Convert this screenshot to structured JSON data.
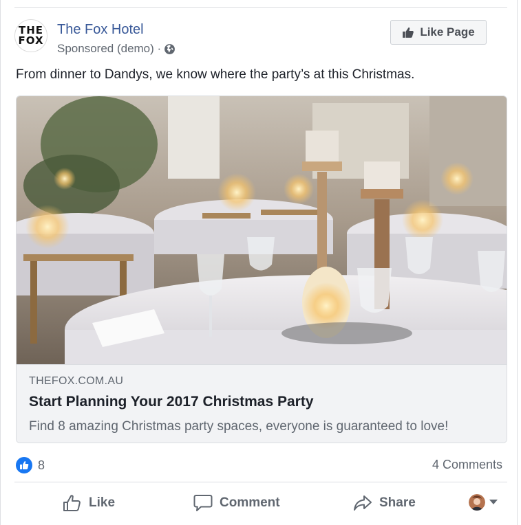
{
  "post": {
    "page_name": "The Fox Hotel",
    "avatar_line1": "THE",
    "avatar_line2": "FOX",
    "sponsored": "Sponsored (demo) ·",
    "like_page_label": "Like Page",
    "message": "From dinner to Dandys, we know where the party’s at this Christmas."
  },
  "link": {
    "domain": "THEFOX.COM.AU",
    "headline": "Start Planning Your 2017 Christmas Party",
    "description": "Find 8 amazing Christmas party spaces, everyone is guaranteed to love!"
  },
  "stats": {
    "like_count": "8",
    "comments": "4 Comments"
  },
  "actions": {
    "like": "Like",
    "comment": "Comment",
    "share": "Share"
  },
  "icons": {
    "globe": "globe-icon",
    "thumb": "thumbs-up-icon",
    "comment": "speech-bubble-icon",
    "share": "share-arrow-icon",
    "caret": "caret-down-icon"
  },
  "colors": {
    "link_blue": "#385898",
    "like_blue": "#1877f2",
    "gray_text": "#606770"
  }
}
